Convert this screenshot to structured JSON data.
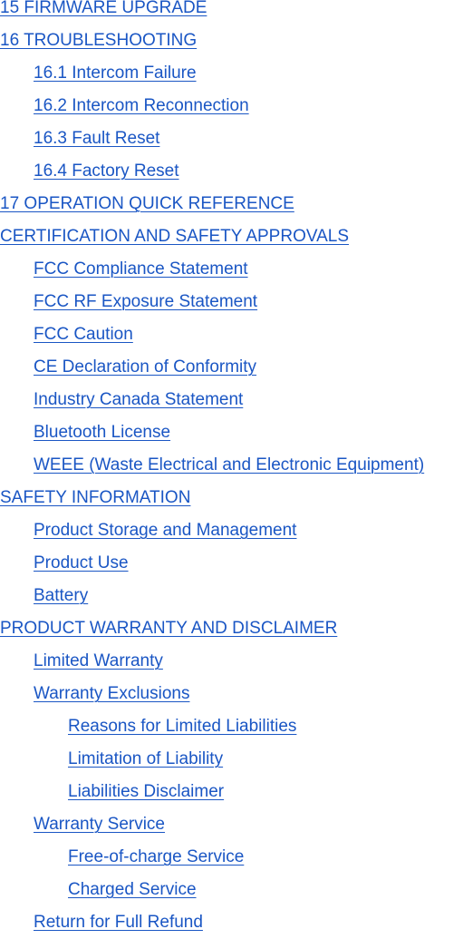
{
  "toc": {
    "link_color": "#1a56c4",
    "entries": [
      {
        "label": "15 FIRMWARE UPGRADE",
        "level": 0
      },
      {
        "label": "16 TROUBLESHOOTING",
        "level": 0
      },
      {
        "label": "16.1 Intercom Failure",
        "level": 1
      },
      {
        "label": "16.2 Intercom Reconnection",
        "level": 1
      },
      {
        "label": "16.3 Fault Reset",
        "level": 1
      },
      {
        "label": "16.4 Factory Reset",
        "level": 1
      },
      {
        "label": "17 OPERATION QUICK REFERENCE",
        "level": 0
      },
      {
        "label": "CERTIFICATION AND SAFETY APPROVALS",
        "level": 0
      },
      {
        "label": "FCC Compliance Statement",
        "level": 1
      },
      {
        "label": "FCC RF Exposure Statement",
        "level": 1
      },
      {
        "label": "FCC Caution",
        "level": 1
      },
      {
        "label": "CE Declaration of Conformity",
        "level": 1
      },
      {
        "label": "Industry Canada Statement",
        "level": 1
      },
      {
        "label": "Bluetooth License",
        "level": 1
      },
      {
        "label": "WEEE (Waste Electrical and Electronic Equipment)",
        "level": 1
      },
      {
        "label": "SAFETY INFORMATION",
        "level": 0
      },
      {
        "label": "Product Storage and Management",
        "level": 1
      },
      {
        "label": "Product Use",
        "level": 1
      },
      {
        "label": "Battery",
        "level": 1
      },
      {
        "label": "PRODUCT WARRANTY AND DISCLAIMER",
        "level": 0
      },
      {
        "label": "Limited Warranty",
        "level": 1
      },
      {
        "label": "Warranty Exclusions",
        "level": 1
      },
      {
        "label": "Reasons for Limited Liabilities",
        "level": 2
      },
      {
        "label": "Limitation of Liability",
        "level": 2
      },
      {
        "label": "Liabilities Disclaimer",
        "level": 2
      },
      {
        "label": "Warranty Service",
        "level": 1
      },
      {
        "label": "Free-of-charge Service",
        "level": 2
      },
      {
        "label": "Charged Service",
        "level": 2
      },
      {
        "label": "Return for Full Refund",
        "level": 1
      }
    ]
  }
}
